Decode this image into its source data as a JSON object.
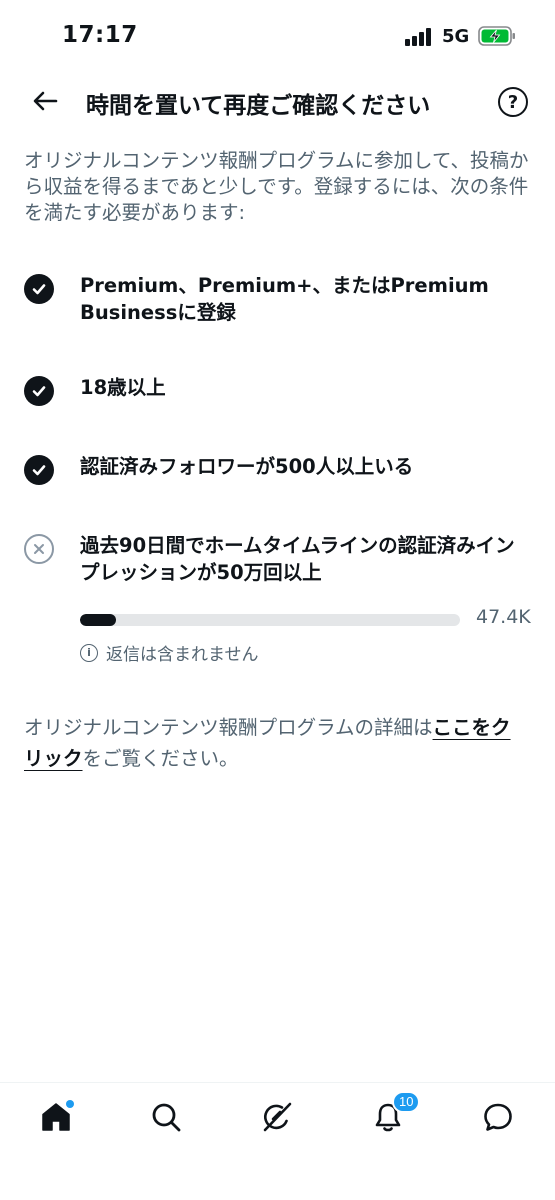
{
  "status_bar": {
    "time": "17:17",
    "network": "5G"
  },
  "header": {
    "title": "時間を置いて再度ご確認ください",
    "help_label": "?"
  },
  "intro": "オリジナルコンテンツ報酬プログラムに参加して、投稿から収益を得るまであと少しです。登録するには、次の条件を満たす必要があります:",
  "requirements": [
    {
      "text": "Premium、Premium+、またはPremium Businessに登録",
      "status": "met"
    },
    {
      "text": "18歳以上",
      "status": "met"
    },
    {
      "text": "認証済みフォロワーが500人以上いる",
      "status": "met"
    },
    {
      "text": "過去90日間でホームタイムラインの認証済みインプレッションが50万回以上",
      "status": "not-met",
      "progress_fraction": 0.095,
      "progress_value": "47.4K",
      "note": "返信は含まれません"
    }
  ],
  "footer": {
    "prefix": "オリジナルコンテンツ報酬プログラムの詳細は",
    "link_label": "ここをクリック",
    "suffix": "をご覧ください。"
  },
  "nav": {
    "notifications_badge": "10"
  },
  "colors": {
    "text_primary": "#0f1419",
    "text_secondary": "#536471",
    "accent": "#1d9bf0",
    "battery_charging": "#00ba34"
  },
  "icons": [
    "back-arrow-icon",
    "help-icon",
    "check-icon",
    "x-icon",
    "info-icon",
    "home-icon",
    "search-icon",
    "grok-icon",
    "bell-icon",
    "message-icon"
  ]
}
